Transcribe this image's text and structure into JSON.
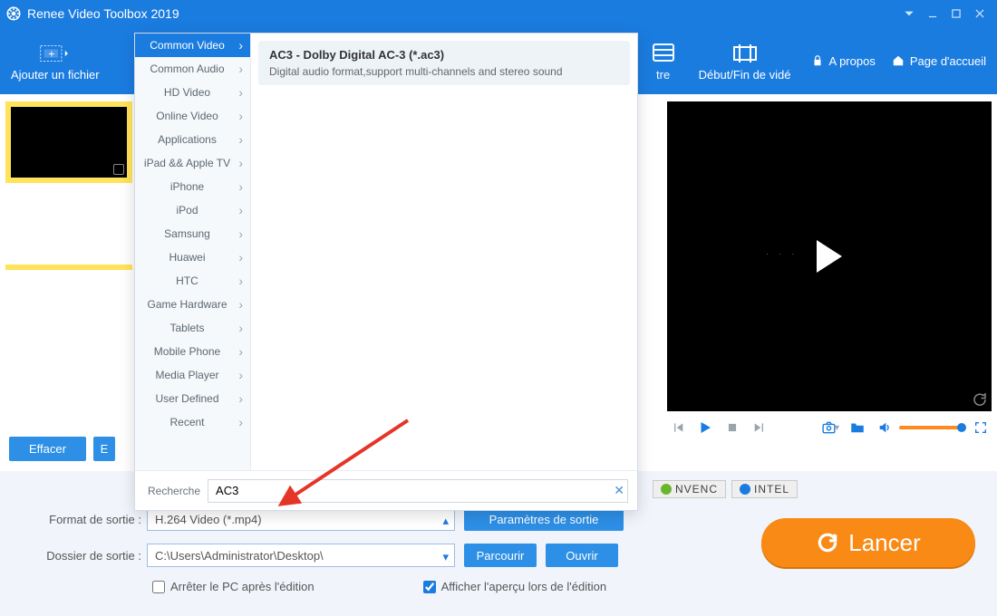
{
  "title": "Renee Video Toolbox 2019",
  "toolbar": {
    "add_file": "Ajouter un fichier",
    "headers_visible": [
      "tre",
      "Début/Fin de vidé"
    ],
    "about": "A propos",
    "home": "Page d'accueil"
  },
  "thumbs": {
    "count": 1
  },
  "left_buttons": {
    "clear": "Effacer",
    "edit_partial": "E"
  },
  "dropdown": {
    "categories": [
      "Common Video",
      "Common Audio",
      "HD Video",
      "Online Video",
      "Applications",
      "iPad && Apple TV",
      "iPhone",
      "iPod",
      "Samsung",
      "Huawei",
      "HTC",
      "Game Hardware",
      "Tablets",
      "Mobile Phone",
      "Media Player",
      "User Defined",
      "Recent"
    ],
    "active_index": 0,
    "result": {
      "title": "AC3 - Dolby Digital AC-3 (*.ac3)",
      "desc": "Digital audio format,support multi-channels and stereo sound"
    },
    "search_label": "Recherche",
    "search_value": "AC3"
  },
  "preview_controls": {
    "icons": [
      "prev",
      "play",
      "stop",
      "next",
      "camera",
      "folder",
      "volume",
      "fullscreen"
    ]
  },
  "gpu": {
    "nvenc": "NVENC",
    "intel": "INTEL"
  },
  "form": {
    "format_label": "Format de sortie :",
    "format_value": "H.264 Video (*.mp4)",
    "params_btn": "Paramètres de sortie",
    "folder_label": "Dossier de sortie :",
    "folder_value": "C:\\Users\\Administrator\\Desktop\\",
    "browse": "Parcourir",
    "open": "Ouvrir",
    "chk_shutdown": "Arrêter le PC après l'édition",
    "chk_preview": "Afficher l'aperçu lors de l'édition"
  },
  "launch": "Lancer"
}
